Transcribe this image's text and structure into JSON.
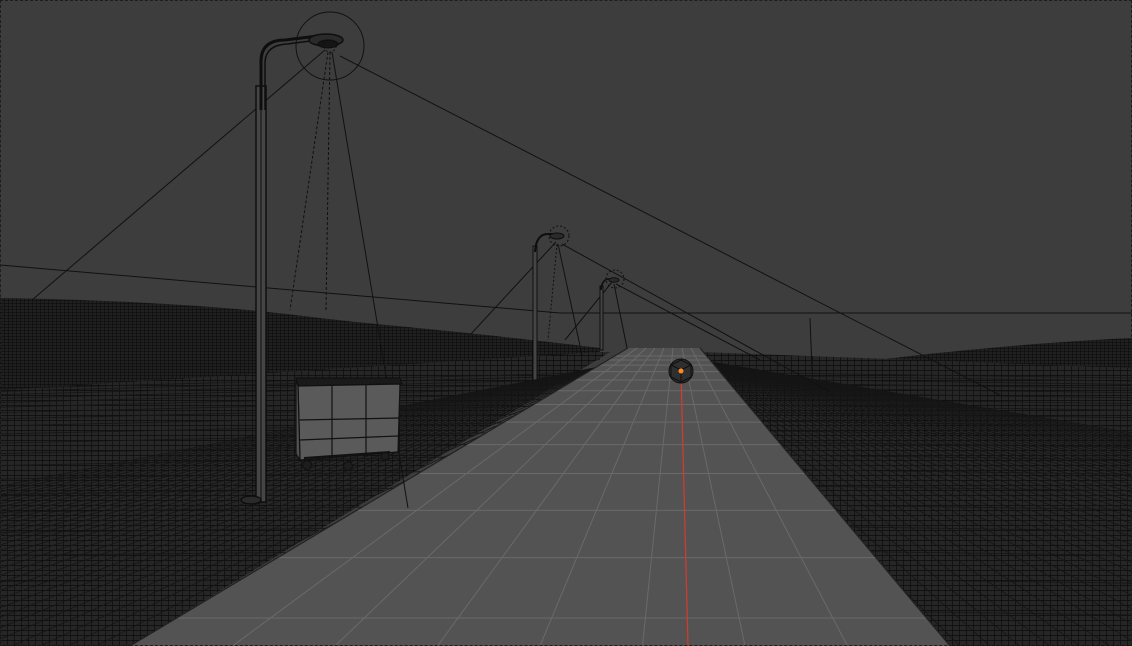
{
  "viewport": {
    "mode": "wireframe",
    "background_color": "#3d3d3d",
    "wire_color": "#111111",
    "grid_color": "#8a8a8a",
    "x_axis_color": "#d63a2c",
    "origin_color": "#ff8a1c"
  },
  "scene_objects": [
    "street-lamp-icon",
    "street-lamp-icon",
    "street-lamp-icon",
    "dumpster-icon",
    "empty-cube-icon",
    "terrain-mesh",
    "road-mesh"
  ]
}
